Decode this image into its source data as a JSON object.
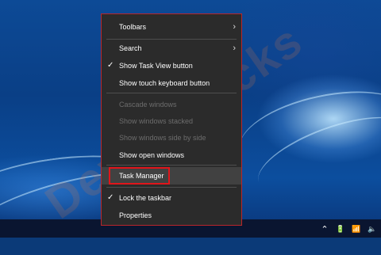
{
  "watermark": "DeviceTricks",
  "menu": {
    "toolbars": "Toolbars",
    "search": "Search",
    "show_task_view": "Show Task View button",
    "show_touch_keyboard": "Show touch keyboard button",
    "cascade": "Cascade windows",
    "stacked": "Show windows stacked",
    "side_by_side": "Show windows side by side",
    "show_open": "Show open windows",
    "task_manager": "Task Manager",
    "lock_taskbar": "Lock the taskbar",
    "properties": "Properties",
    "submenu_glyph": "›",
    "check_glyph": "✓"
  },
  "tray": {
    "chevron": "⌃",
    "battery": "🔋",
    "wifi": "📶",
    "volume": "🔈"
  },
  "colors": {
    "menu_bg": "#2b2b2b",
    "highlight_border": "#e1151b",
    "taskbar": "#0a142d"
  }
}
